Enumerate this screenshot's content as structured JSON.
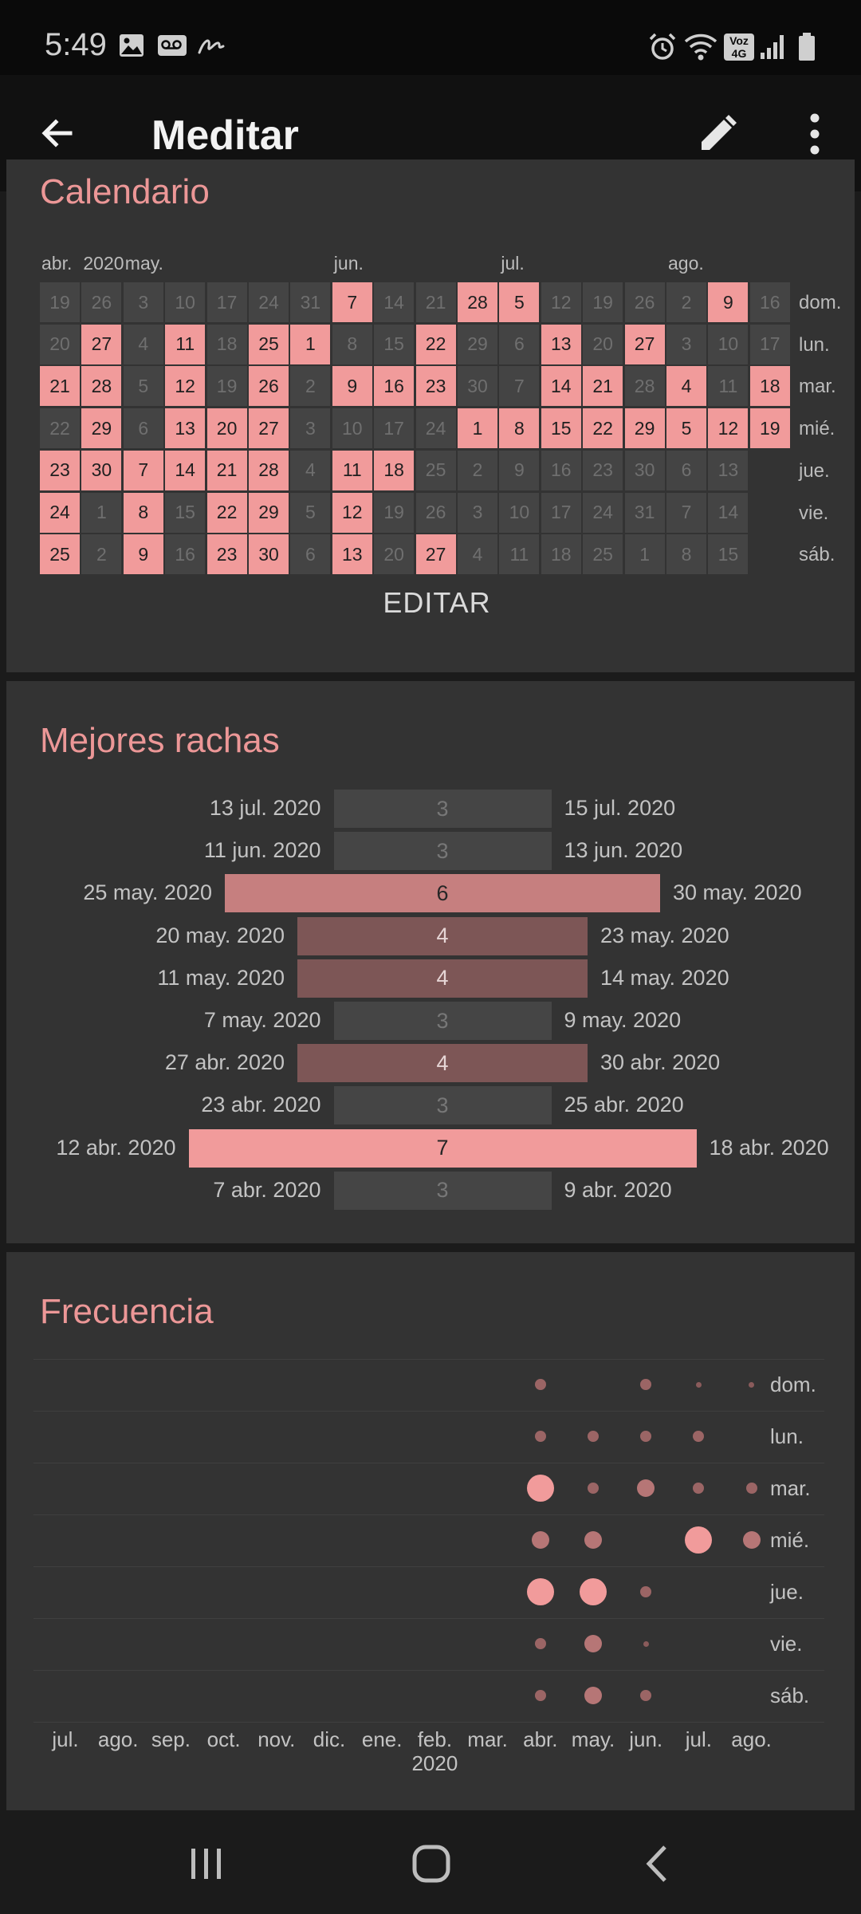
{
  "status_bar": {
    "time": "5:49",
    "left_icons": [
      "gallery-icon",
      "voicemail-icon",
      "signature-icon"
    ],
    "right_icons": [
      "alarm-icon",
      "wifi-icon",
      "volte-4g-icon",
      "signal-icon",
      "battery-icon"
    ],
    "volte_text": "Voz",
    "network_text": "4G"
  },
  "app_bar": {
    "title": "Meditar",
    "back_icon": "arrow-left-icon",
    "edit_icon": "pencil-icon",
    "more_icon": "more-vert-icon"
  },
  "calendar": {
    "title": "Calendario",
    "header_labels": [
      {
        "col": 0,
        "text": "abr."
      },
      {
        "col": 1,
        "text": "2020"
      },
      {
        "col": 2,
        "text": "may."
      },
      {
        "col": 7,
        "text": "jun."
      },
      {
        "col": 11,
        "text": "jul."
      },
      {
        "col": 15,
        "text": "ago."
      }
    ],
    "day_labels": [
      "dom.",
      "lun.",
      "mar.",
      "mié.",
      "jue.",
      "vie.",
      "sáb."
    ],
    "grid": [
      [
        {
          "d": "19",
          "a": 0
        },
        {
          "d": "26",
          "a": 0
        },
        {
          "d": "3",
          "a": 0
        },
        {
          "d": "10",
          "a": 0
        },
        {
          "d": "17",
          "a": 0
        },
        {
          "d": "24",
          "a": 0
        },
        {
          "d": "31",
          "a": 0
        },
        {
          "d": "7",
          "a": 1
        },
        {
          "d": "14",
          "a": 0
        },
        {
          "d": "21",
          "a": 0
        },
        {
          "d": "28",
          "a": 1
        },
        {
          "d": "5",
          "a": 1
        },
        {
          "d": "12",
          "a": 0
        },
        {
          "d": "19",
          "a": 0
        },
        {
          "d": "26",
          "a": 0
        },
        {
          "d": "2",
          "a": 0
        },
        {
          "d": "9",
          "a": 1
        },
        {
          "d": "16",
          "a": 0
        }
      ],
      [
        {
          "d": "20",
          "a": 0
        },
        {
          "d": "27",
          "a": 1
        },
        {
          "d": "4",
          "a": 0
        },
        {
          "d": "11",
          "a": 1
        },
        {
          "d": "18",
          "a": 0
        },
        {
          "d": "25",
          "a": 1
        },
        {
          "d": "1",
          "a": 1
        },
        {
          "d": "8",
          "a": 0
        },
        {
          "d": "15",
          "a": 0
        },
        {
          "d": "22",
          "a": 1
        },
        {
          "d": "29",
          "a": 0
        },
        {
          "d": "6",
          "a": 0
        },
        {
          "d": "13",
          "a": 1
        },
        {
          "d": "20",
          "a": 0
        },
        {
          "d": "27",
          "a": 1
        },
        {
          "d": "3",
          "a": 0
        },
        {
          "d": "10",
          "a": 0
        },
        {
          "d": "17",
          "a": 0
        }
      ],
      [
        {
          "d": "21",
          "a": 1
        },
        {
          "d": "28",
          "a": 1
        },
        {
          "d": "5",
          "a": 0
        },
        {
          "d": "12",
          "a": 1
        },
        {
          "d": "19",
          "a": 0
        },
        {
          "d": "26",
          "a": 1
        },
        {
          "d": "2",
          "a": 0
        },
        {
          "d": "9",
          "a": 1
        },
        {
          "d": "16",
          "a": 1
        },
        {
          "d": "23",
          "a": 1
        },
        {
          "d": "30",
          "a": 0
        },
        {
          "d": "7",
          "a": 0
        },
        {
          "d": "14",
          "a": 1
        },
        {
          "d": "21",
          "a": 1
        },
        {
          "d": "28",
          "a": 0
        },
        {
          "d": "4",
          "a": 1
        },
        {
          "d": "11",
          "a": 0
        },
        {
          "d": "18",
          "a": 1
        }
      ],
      [
        {
          "d": "22",
          "a": 0
        },
        {
          "d": "29",
          "a": 1
        },
        {
          "d": "6",
          "a": 0
        },
        {
          "d": "13",
          "a": 1
        },
        {
          "d": "20",
          "a": 1
        },
        {
          "d": "27",
          "a": 1
        },
        {
          "d": "3",
          "a": 0
        },
        {
          "d": "10",
          "a": 0
        },
        {
          "d": "17",
          "a": 0
        },
        {
          "d": "24",
          "a": 0
        },
        {
          "d": "1",
          "a": 1
        },
        {
          "d": "8",
          "a": 1
        },
        {
          "d": "15",
          "a": 1
        },
        {
          "d": "22",
          "a": 1
        },
        {
          "d": "29",
          "a": 1
        },
        {
          "d": "5",
          "a": 1
        },
        {
          "d": "12",
          "a": 1
        },
        {
          "d": "19",
          "a": 1
        }
      ],
      [
        {
          "d": "23",
          "a": 1
        },
        {
          "d": "30",
          "a": 1
        },
        {
          "d": "7",
          "a": 1
        },
        {
          "d": "14",
          "a": 1
        },
        {
          "d": "21",
          "a": 1
        },
        {
          "d": "28",
          "a": 1
        },
        {
          "d": "4",
          "a": 0
        },
        {
          "d": "11",
          "a": 1
        },
        {
          "d": "18",
          "a": 1
        },
        {
          "d": "25",
          "a": 0
        },
        {
          "d": "2",
          "a": 0
        },
        {
          "d": "9",
          "a": 0
        },
        {
          "d": "16",
          "a": 0
        },
        {
          "d": "23",
          "a": 0
        },
        {
          "d": "30",
          "a": 0
        },
        {
          "d": "6",
          "a": 0
        },
        {
          "d": "13",
          "a": 0
        }
      ],
      [
        {
          "d": "24",
          "a": 1
        },
        {
          "d": "1",
          "a": 0
        },
        {
          "d": "8",
          "a": 1
        },
        {
          "d": "15",
          "a": 0
        },
        {
          "d": "22",
          "a": 1
        },
        {
          "d": "29",
          "a": 1
        },
        {
          "d": "5",
          "a": 0
        },
        {
          "d": "12",
          "a": 1
        },
        {
          "d": "19",
          "a": 0
        },
        {
          "d": "26",
          "a": 0
        },
        {
          "d": "3",
          "a": 0
        },
        {
          "d": "10",
          "a": 0
        },
        {
          "d": "17",
          "a": 0
        },
        {
          "d": "24",
          "a": 0
        },
        {
          "d": "31",
          "a": 0
        },
        {
          "d": "7",
          "a": 0
        },
        {
          "d": "14",
          "a": 0
        }
      ],
      [
        {
          "d": "25",
          "a": 1
        },
        {
          "d": "2",
          "a": 0
        },
        {
          "d": "9",
          "a": 1
        },
        {
          "d": "16",
          "a": 0
        },
        {
          "d": "23",
          "a": 1
        },
        {
          "d": "30",
          "a": 1
        },
        {
          "d": "6",
          "a": 0
        },
        {
          "d": "13",
          "a": 1
        },
        {
          "d": "20",
          "a": 0
        },
        {
          "d": "27",
          "a": 1
        },
        {
          "d": "4",
          "a": 0
        },
        {
          "d": "11",
          "a": 0
        },
        {
          "d": "18",
          "a": 0
        },
        {
          "d": "25",
          "a": 0
        },
        {
          "d": "1",
          "a": 0
        },
        {
          "d": "8",
          "a": 0
        },
        {
          "d": "15",
          "a": 0
        }
      ]
    ],
    "edit_label": "EDITAR"
  },
  "streaks": {
    "title": "Mejores rachas",
    "items": [
      {
        "start": "13 jul. 2020",
        "end": "15 jul. 2020",
        "length": 3
      },
      {
        "start": "11 jun. 2020",
        "end": "13 jun. 2020",
        "length": 3
      },
      {
        "start": "25 may. 2020",
        "end": "30 may. 2020",
        "length": 6
      },
      {
        "start": "20 may. 2020",
        "end": "23 may. 2020",
        "length": 4
      },
      {
        "start": "11 may. 2020",
        "end": "14 may. 2020",
        "length": 4
      },
      {
        "start": "7 may. 2020",
        "end": "9 may. 2020",
        "length": 3
      },
      {
        "start": "27 abr. 2020",
        "end": "30 abr. 2020",
        "length": 4
      },
      {
        "start": "23 abr. 2020",
        "end": "25 abr. 2020",
        "length": 3
      },
      {
        "start": "12 abr. 2020",
        "end": "18 abr. 2020",
        "length": 7
      },
      {
        "start": "7 abr. 2020",
        "end": "9 abr. 2020",
        "length": 3
      }
    ]
  },
  "frequency": {
    "title": "Frecuencia",
    "days": [
      "dom.",
      "lun.",
      "mar.",
      "mié.",
      "jue.",
      "vie.",
      "sáb."
    ],
    "months": [
      "jul.",
      "ago.",
      "sep.",
      "oct.",
      "nov.",
      "dic.",
      "ene.",
      "feb.",
      "mar.",
      "abr.",
      "may.",
      "jun.",
      "jul.",
      "ago."
    ],
    "year_label": {
      "month_index": 7,
      "text": "2020"
    },
    "max_count": 4,
    "counts": [
      [
        0,
        0,
        0,
        0,
        0,
        0,
        0,
        0,
        0,
        2,
        0,
        2,
        1,
        1
      ],
      [
        0,
        0,
        0,
        0,
        0,
        0,
        0,
        0,
        0,
        2,
        2,
        2,
        2,
        0
      ],
      [
        0,
        0,
        0,
        0,
        0,
        0,
        0,
        0,
        0,
        4,
        2,
        3,
        2,
        2
      ],
      [
        0,
        0,
        0,
        0,
        0,
        0,
        0,
        0,
        0,
        3,
        3,
        0,
        4,
        3
      ],
      [
        0,
        0,
        0,
        0,
        0,
        0,
        0,
        0,
        0,
        4,
        4,
        2,
        0,
        0
      ],
      [
        0,
        0,
        0,
        0,
        0,
        0,
        0,
        0,
        0,
        2,
        3,
        1,
        0,
        0
      ],
      [
        0,
        0,
        0,
        0,
        0,
        0,
        0,
        0,
        0,
        2,
        3,
        2,
        0,
        0
      ]
    ],
    "accent": "#f19b9b"
  },
  "nav_bar": {
    "icons": [
      "recent-apps-icon",
      "home-icon",
      "back-icon"
    ]
  }
}
